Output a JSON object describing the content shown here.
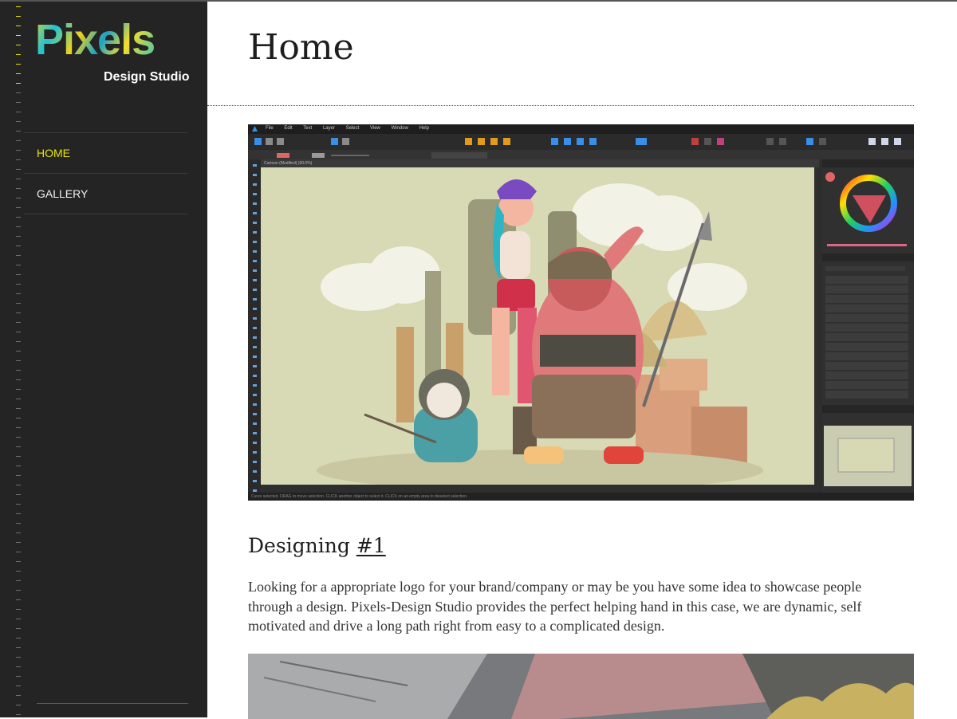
{
  "sidebar": {
    "logo": {
      "title": "Pixels",
      "subtitle": "Design Studio"
    },
    "nav": [
      {
        "label": "HOME",
        "active": true
      },
      {
        "label": "GALLERY",
        "active": false
      }
    ]
  },
  "main": {
    "page_title": "Home",
    "section": {
      "heading": "Designing",
      "heading_number": "#1",
      "paragraph": "Looking for a appropriate logo for your brand/company or may be you have some idea to showcase people through a design. Pixels-Design Studio provides the perfect helping hand in this case, we are dynamic, self motivated and drive a long path right from easy to a complicated design."
    },
    "screenshot": {
      "menu": [
        "File",
        "Edit",
        "Text",
        "Layer",
        "Select",
        "View",
        "Window",
        "Help"
      ],
      "document_tab": "Cartoon (Modified) (60.0%)",
      "status": "Curve selected. DRAG to move selection. CLICK another object to select it. CLICK on an empty area to deselect selection."
    }
  },
  "colors": {
    "sidebar_bg": "#242424",
    "nav_active": "#e8e400",
    "nav_text": "#f2f2f2",
    "logo_teal": "#1fc2d6",
    "logo_yellow": "#f0d21a"
  }
}
